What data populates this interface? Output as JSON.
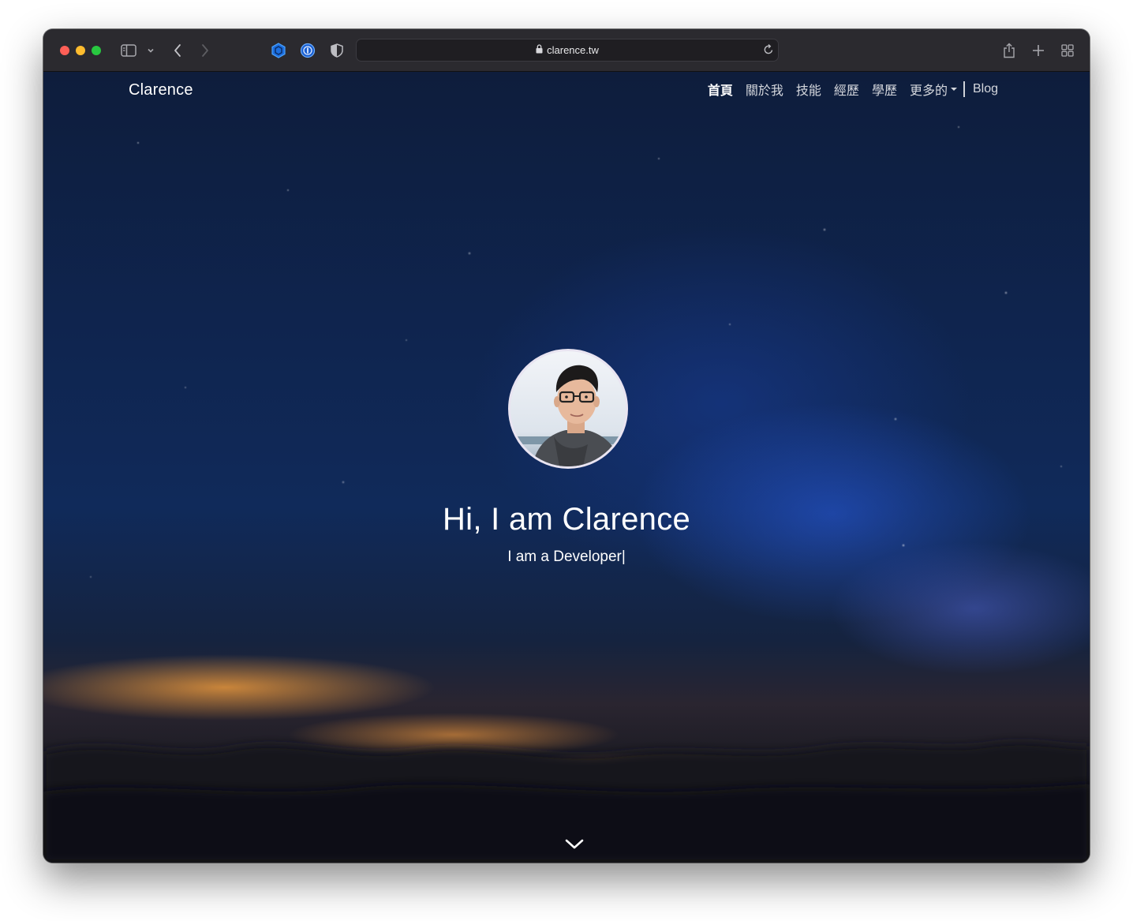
{
  "browser": {
    "url": "clarence.tw",
    "traffic_lights": {
      "close": "#ff5f57",
      "minimize": "#febc2e",
      "zoom": "#28c840"
    },
    "icons": [
      "sidebar-icon",
      "chevron-down-icon",
      "back-icon",
      "forward-icon",
      "extension-hex-icon",
      "password-manager-icon",
      "privacy-shield-icon",
      "lock-icon",
      "reload-icon",
      "share-icon",
      "new-tab-icon",
      "tab-overview-icon"
    ]
  },
  "site": {
    "brand": "Clarence",
    "nav": {
      "home": "首頁",
      "about": "關於我",
      "skills": "技能",
      "experience": "經歷",
      "education": "學歷",
      "more": "更多的",
      "blog": "Blog"
    },
    "hero": {
      "title": "Hi, I am Clarence",
      "subtitle": "I am a Developer|"
    }
  },
  "colors": {
    "accent_active_nav": "#ffffff",
    "titlebar": "#2b2a2f",
    "sky": "#102a5a"
  }
}
